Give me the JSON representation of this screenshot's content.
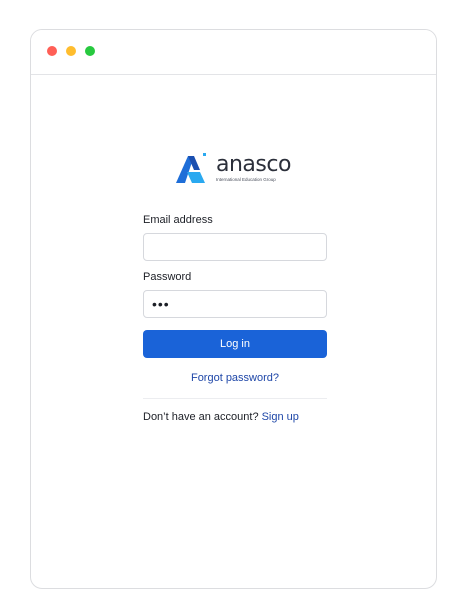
{
  "window": {
    "controls": [
      "close",
      "minimize",
      "maximize"
    ]
  },
  "logo": {
    "word": "anasco",
    "tagline": "International Education Group",
    "icon": "anasco-logo-icon"
  },
  "form": {
    "email_label": "Email address",
    "email_value": "",
    "email_placeholder": "",
    "password_label": "Password",
    "password_value": "•••",
    "login_label": "Log in",
    "forgot_label": "Forgot password?",
    "signup_prompt": "Don’t have an account?",
    "signup_label": "Sign up"
  },
  "colors": {
    "primary": "#1a63d8",
    "link": "#1f47a8",
    "close": "#ff5f56",
    "minimize": "#ffbd2e",
    "maximize": "#27c93f"
  }
}
